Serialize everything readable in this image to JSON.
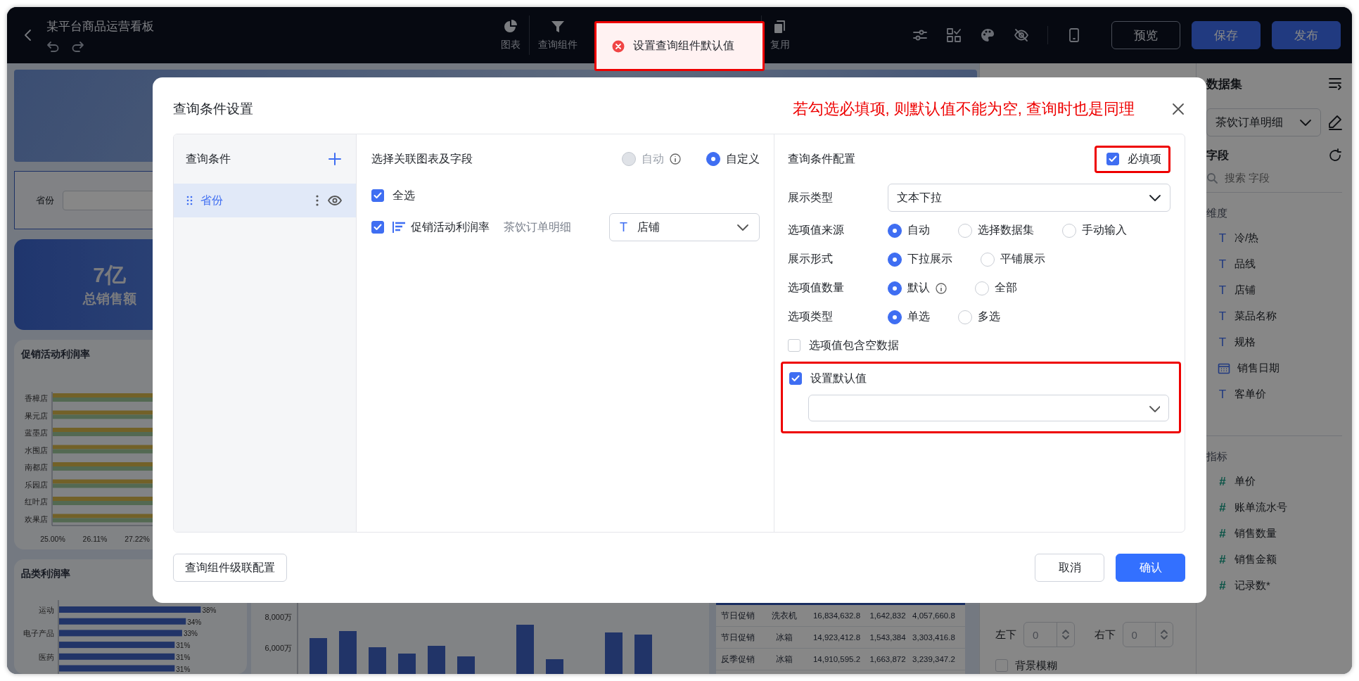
{
  "window": {
    "title": "某平台商品运营看板"
  },
  "toolbar": {
    "groups": [
      {
        "items": [
          {
            "label": "图表"
          }
        ]
      },
      {
        "items": [
          {
            "label": "查询组件"
          }
        ]
      },
      {
        "items": [
          {
            "label": "复用"
          }
        ]
      }
    ],
    "buttons": [
      {
        "label": "预览",
        "kind": "secondary"
      },
      {
        "label": "保存",
        "kind": "primary"
      },
      {
        "label": "发布",
        "kind": "primary"
      }
    ]
  },
  "toast": {
    "message": "设置查询组件默认值",
    "kind": "error",
    "highlighted": true
  },
  "canvas": {
    "query_filter": {
      "label": "省份"
    },
    "kpi": {
      "value": "7亿",
      "label": "总销售额"
    },
    "promo_chart": {
      "title": "促销活动利润率",
      "categories": [
        "香樟店",
        "果元店",
        "蓝墨店",
        "水围店",
        "南都店",
        "乐园店",
        "红叶店",
        "欢果店"
      ],
      "xticks": [
        "25.00%",
        "26.11%",
        "27.22%"
      ]
    },
    "category_chart": {
      "title": "品类利润率",
      "chart_data": {
        "type": "bar",
        "orientation": "horizontal",
        "categories": [
          "运动",
          null,
          "电子产品",
          null,
          "医药",
          null
        ],
        "values": [
          38,
          34,
          33,
          31,
          31,
          31
        ],
        "value_labels": [
          "38%",
          "34%",
          "33%",
          "31%",
          "31%",
          "31%"
        ]
      }
    },
    "sales_chart": {
      "axis_labels": [
        "8,000万",
        "6,000万"
      ]
    },
    "table": {
      "rows": [
        [
          "节日促销",
          "洗衣机",
          "16,834,632.8",
          "1,642,832",
          "4,057,660.8"
        ],
        [
          "节日促销",
          "冰箱",
          "14,923,412.8",
          "1,543,384",
          "3,303,416.8"
        ],
        [
          "反季促销",
          "冰箱",
          "14,910,595.2",
          "1,663,872",
          "3,239,347.2"
        ]
      ]
    }
  },
  "properties": {
    "corners": [
      {
        "label": "左下",
        "value": "0"
      },
      {
        "label": "右下",
        "value": "0"
      }
    ],
    "background_blur": {
      "label": "背景模糊",
      "checked": false
    }
  },
  "dataset_panel": {
    "title": "数据集",
    "dataset": "茶饮订单明细",
    "fields_title": "字段",
    "search_placeholder": "搜索 字段",
    "dimensions": {
      "title": "维度",
      "items": [
        {
          "name": "冷/热",
          "kind": "text",
          "glyph": "T"
        },
        {
          "name": "品线",
          "kind": "text",
          "glyph": "T"
        },
        {
          "name": "店铺",
          "kind": "text",
          "glyph": "T"
        },
        {
          "name": "菜品名称",
          "kind": "text",
          "glyph": "T"
        },
        {
          "name": "规格",
          "kind": "text",
          "glyph": "T"
        },
        {
          "name": "销售日期",
          "kind": "date"
        },
        {
          "name": "客单价",
          "kind": "text",
          "glyph": "T"
        }
      ]
    },
    "measures": {
      "title": "指标",
      "items": [
        {
          "name": "单价",
          "kind": "number",
          "glyph": "#"
        },
        {
          "name": "账单流水号",
          "kind": "number",
          "glyph": "#"
        },
        {
          "name": "销售数量",
          "kind": "number",
          "glyph": "#"
        },
        {
          "name": "销售金额",
          "kind": "number",
          "glyph": "#"
        },
        {
          "name": "记录数*",
          "kind": "number",
          "glyph": "#"
        }
      ]
    }
  },
  "dialog": {
    "title": "查询条件设置",
    "annotation": "若勾选必填项, 则默认值不能为空, 查询时也是同理",
    "conditions": {
      "heading": "查询条件",
      "items": [
        {
          "label": "省份",
          "selected": true
        }
      ]
    },
    "linking": {
      "heading": "选择关联图表及字段",
      "modes": [
        {
          "label": "自动",
          "selected": false,
          "disabled": true,
          "info": true
        },
        {
          "label": "自定义",
          "selected": true,
          "disabled": false
        }
      ],
      "select_all": {
        "label": "全选",
        "checked": true
      },
      "charts": [
        {
          "name": "促销活动利润率",
          "dataset": "茶饮订单明细",
          "field_glyph": "T",
          "field": "店铺",
          "checked": true
        }
      ]
    },
    "config": {
      "heading": "查询条件配置",
      "required": {
        "label": "必填项",
        "checked": true,
        "highlighted": true
      },
      "display_type": {
        "label": "展示类型",
        "value": "文本下拉"
      },
      "radio_rows": [
        {
          "label": "选项值来源",
          "options": [
            {
              "label": "自动",
              "selected": true
            },
            {
              "label": "选择数据集",
              "selected": false
            },
            {
              "label": "手动输入",
              "selected": false
            }
          ]
        },
        {
          "label": "展示形式",
          "options": [
            {
              "label": "下拉展示",
              "selected": true
            },
            {
              "label": "平铺展示",
              "selected": false
            }
          ]
        },
        {
          "label": "选项值数量",
          "options": [
            {
              "label": "默认",
              "selected": true,
              "info": true
            },
            {
              "label": "全部",
              "selected": false
            }
          ]
        },
        {
          "label": "选项类型",
          "options": [
            {
              "label": "单选",
              "selected": true
            },
            {
              "label": "多选",
              "selected": false
            }
          ]
        }
      ],
      "include_empty": {
        "label": "选项值包含空数据",
        "checked": false
      },
      "default_value": {
        "label": "设置默认值",
        "checked": true,
        "highlighted": true
      }
    },
    "cascade_button": "查询组件级联配置",
    "buttons": [
      {
        "label": "取消",
        "kind": "secondary"
      },
      {
        "label": "确认",
        "kind": "primary"
      }
    ]
  }
}
